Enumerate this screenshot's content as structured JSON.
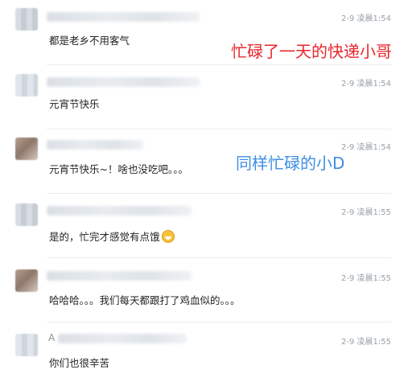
{
  "comments": [
    {
      "time": "2-9 凌晨1:54",
      "text": "都是老乡不用客气"
    },
    {
      "time": "2-9 凌晨1:54",
      "text": "元宵节快乐"
    },
    {
      "time": "2-9 凌晨1:54",
      "text": "元宵节快乐~！啥也没吃吧。。。"
    },
    {
      "time": "2-9 凌晨1:55",
      "text": "是的，忙完才感觉有点饿"
    },
    {
      "time": "2-9 凌晨1:55",
      "text": "哈哈哈。。。我们每天都跟打了鸡血似的。。。"
    },
    {
      "time": "2-9 凌晨1:55",
      "text": "你们也很辛苦",
      "name_initial": "A"
    }
  ],
  "annotations": {
    "red": "忙碌了一天的快递小哥",
    "blue": "同样忙碌的小D"
  },
  "icons": {
    "laugh_cry": "laughing-crying-emoji-icon"
  }
}
